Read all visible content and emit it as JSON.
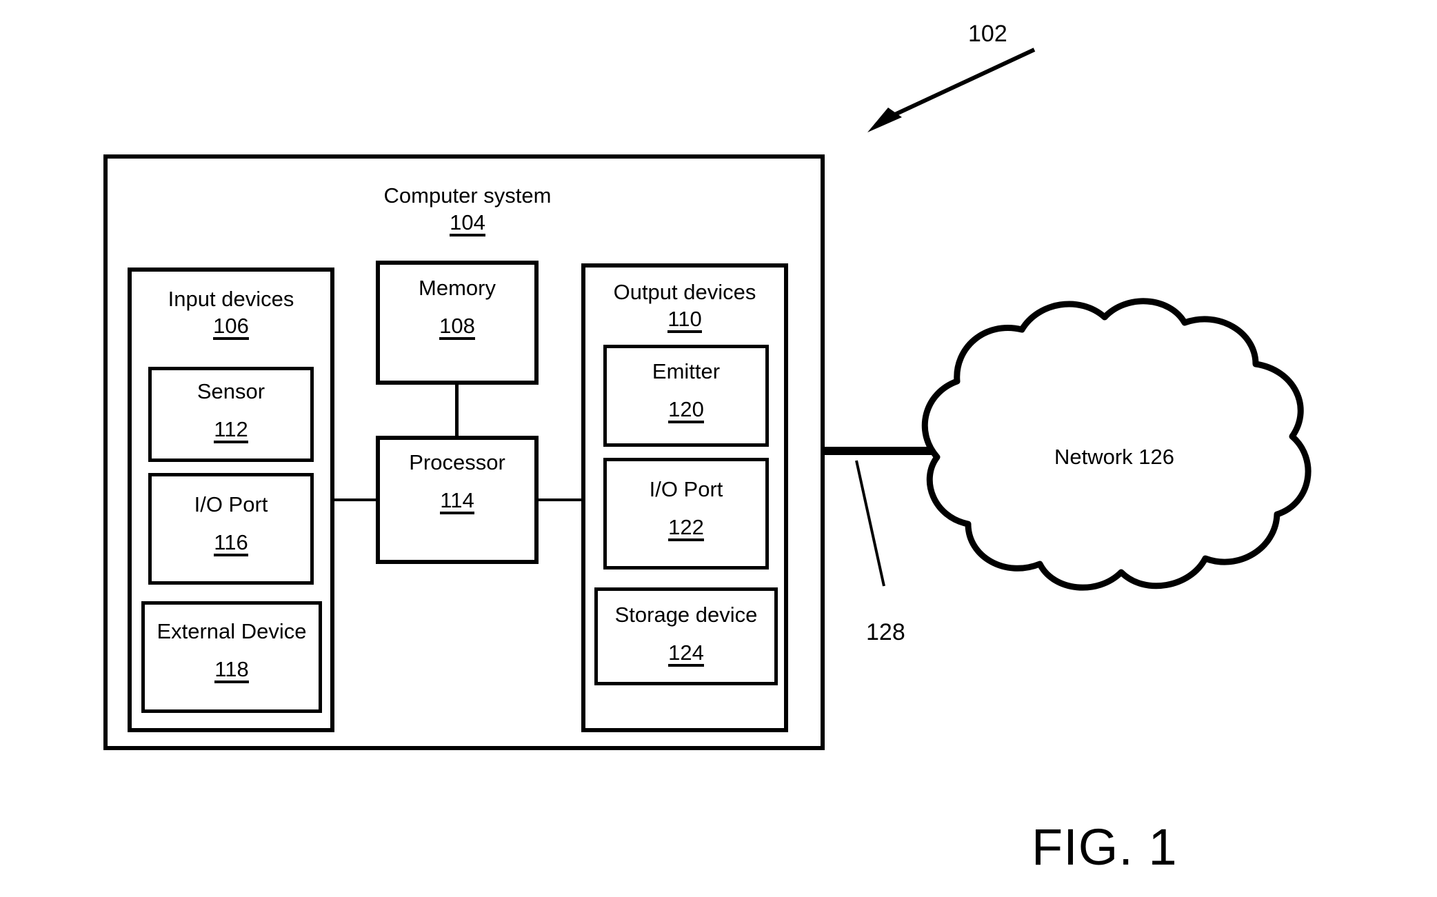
{
  "figure": {
    "caption": "FIG. 1",
    "system_ref": "102",
    "link_ref": "128"
  },
  "computer_system": {
    "title": "Computer system",
    "ref": "104"
  },
  "input_devices": {
    "title": "Input devices",
    "ref": "106",
    "children": [
      {
        "title": "Sensor",
        "ref": "112"
      },
      {
        "title": "I/O Port",
        "ref": "116"
      },
      {
        "title": "External Device",
        "ref": "118"
      }
    ]
  },
  "memory": {
    "title": "Memory",
    "ref": "108"
  },
  "processor": {
    "title": "Processor",
    "ref": "114"
  },
  "output_devices": {
    "title": "Output devices",
    "ref": "110",
    "children": [
      {
        "title": "Emitter",
        "ref": "120"
      },
      {
        "title": "I/O Port",
        "ref": "122"
      },
      {
        "title": "Storage device",
        "ref": "124"
      }
    ]
  },
  "network": {
    "title": "Network",
    "ref": "126"
  },
  "colors": {
    "stroke": "#000000",
    "background": "#ffffff"
  }
}
